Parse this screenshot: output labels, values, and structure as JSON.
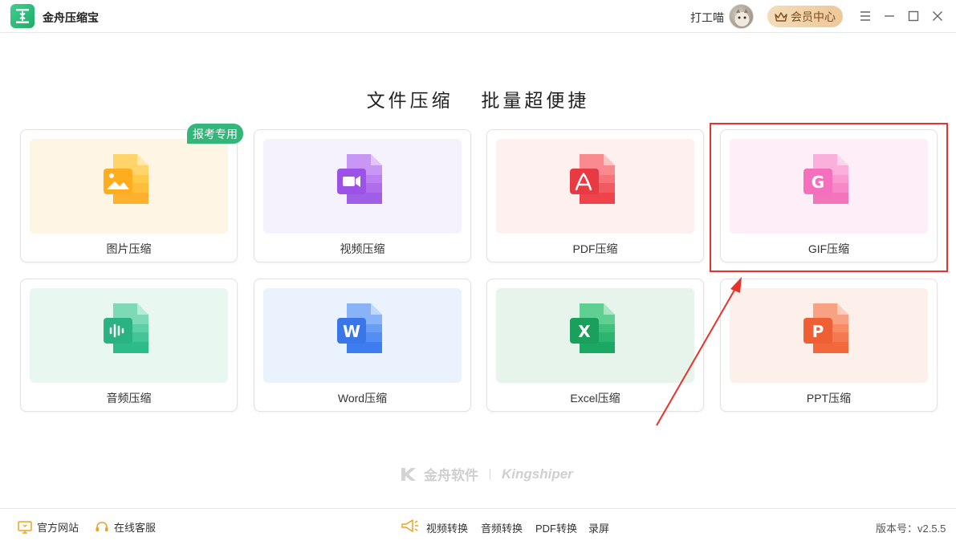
{
  "app": {
    "title": "金舟压缩宝"
  },
  "header": {
    "user_name": "打工喵",
    "vip_label": "会员中心"
  },
  "main": {
    "headline_left": "文件压缩",
    "headline_right": "批量超便捷"
  },
  "cards": [
    {
      "label": "图片压缩",
      "badge": "报考专用",
      "color": "#fdba32",
      "bg": "#fff5e4"
    },
    {
      "label": "视频压缩",
      "color": "#a65ee8",
      "bg": "#f5f1fd"
    },
    {
      "label": "PDF压缩",
      "color": "#f0404a",
      "bg": "#fff0f0"
    },
    {
      "label": "GIF压缩",
      "color": "#f36fbc",
      "letter": "G",
      "bg": "#fdeef8"
    },
    {
      "label": "音频压缩",
      "color": "#2dbb8a",
      "bg": "#e9f7f1"
    },
    {
      "label": "Word压缩",
      "color": "#3e7df0",
      "letter": "W",
      "bg": "#e9f2fd"
    },
    {
      "label": "Excel压缩",
      "color": "#1ca863",
      "letter": "X",
      "bg": "#e6f4ec"
    },
    {
      "label": "PPT压缩",
      "color": "#f2673c",
      "letter": "P",
      "bg": "#fdefe9"
    }
  ],
  "brand": {
    "cn": "金舟软件",
    "en": "Kingshiper"
  },
  "footer": {
    "website": "官方网站",
    "service": "在线客服",
    "links": [
      "视频转换",
      "音频转换",
      "PDF转换",
      "录屏"
    ],
    "version": "版本号：v2.5.5"
  },
  "colors": {
    "accent_green": "#32b679",
    "highlight_red": "#e8322c",
    "vip_gold": "#edc899"
  }
}
